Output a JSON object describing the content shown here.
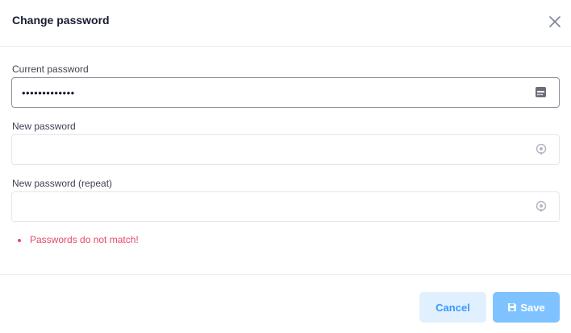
{
  "dialog": {
    "title": "Change password"
  },
  "fields": {
    "current": {
      "label": "Current password",
      "value": "•••••••••••••",
      "icon": "password-manager-icon"
    },
    "new": {
      "label": "New password",
      "value": "",
      "icon": "show-password-icon"
    },
    "repeat": {
      "label": "New password (repeat)",
      "value": "",
      "icon": "show-password-icon"
    }
  },
  "validation": {
    "error": "Passwords do not match!"
  },
  "footer": {
    "cancel_label": "Cancel",
    "save_label": "Save"
  },
  "colors": {
    "primary": "#3699ff",
    "primary_light": "#e1f0ff",
    "save_disabled": "#7ec3ff",
    "error": "#e6496b"
  }
}
